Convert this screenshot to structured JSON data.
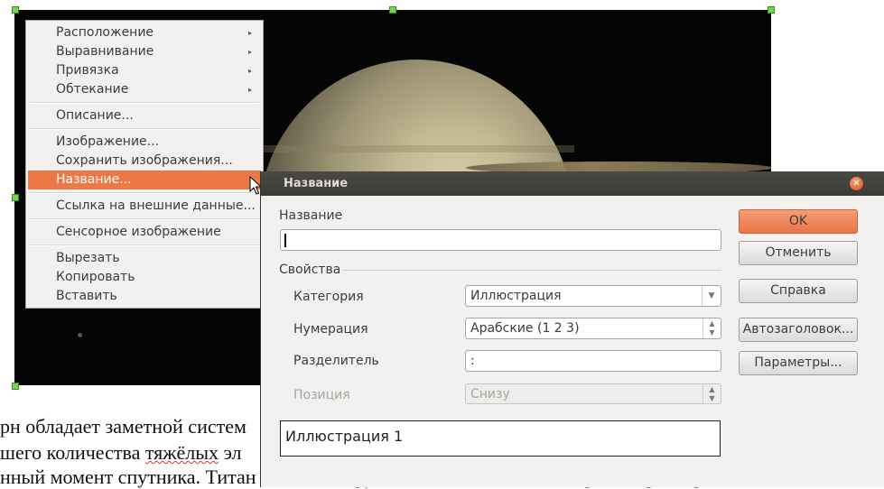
{
  "document": {
    "line1": "рн обладает заметной систем",
    "line2_before": "шего количества ",
    "line2_spell": "тяжёлых",
    "line2_after": " эл",
    "line3": "нный момент спутника. Титан — самый крупный из них, а также второй по размерам"
  },
  "context_menu": {
    "items": [
      {
        "label": "Расположение",
        "submenu": true
      },
      {
        "label": "Выравнивание",
        "submenu": true
      },
      {
        "label": "Привязка",
        "submenu": true
      },
      {
        "label": "Обтекание",
        "submenu": true
      },
      {
        "label": "Описание..."
      },
      {
        "label": "Изображение..."
      },
      {
        "label": "Сохранить изображения..."
      },
      {
        "label": "Название...",
        "highlighted": true
      },
      {
        "label": "Ссылка на внешние данные..."
      },
      {
        "label": "Сенсорное изображение"
      },
      {
        "label": "Вырезать"
      },
      {
        "label": "Копировать"
      },
      {
        "label": "Вставить"
      }
    ],
    "submenu_arrow": "▸"
  },
  "dialog": {
    "title": "Название",
    "close_glyph": "✕",
    "caption_label": "Название",
    "caption_value": "",
    "properties_heading": "Свойства",
    "category_label": "Категория",
    "category_value": "Иллюстрация",
    "numbering_label": "Нумерация",
    "numbering_value": "Арабские (1 2 3)",
    "separator_label": "Разделитель",
    "separator_value": ":",
    "position_label": "Позиция",
    "position_value": "Снизу",
    "preview_text": "Иллюстрация 1",
    "buttons": {
      "ok": "OK",
      "cancel": "Отменить",
      "help": "Справка",
      "autocaption": "Автозаголовок...",
      "options": "Параметры..."
    }
  },
  "colors": {
    "menu_highlight": "#ec7945",
    "titlebar": "#3c3b37",
    "ok_button": "#ea7444",
    "selection_handle": "#72d84a"
  }
}
